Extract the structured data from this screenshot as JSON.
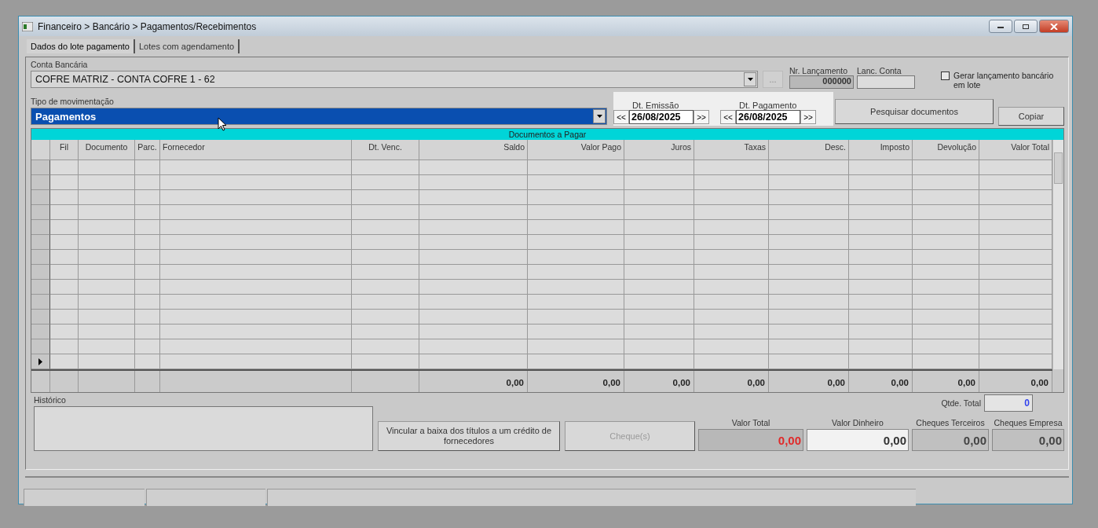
{
  "window": {
    "title": "Financeiro > Bancário > Pagamentos/Recebimentos"
  },
  "tabs": [
    {
      "label": "Dados do lote pagamento",
      "selected": true
    },
    {
      "label": "Lotes com agendamento",
      "selected": false
    }
  ],
  "conta_bancaria": {
    "label": "Conta Bancária",
    "value": "COFRE MATRIZ - CONTA COFRE 1 - 62"
  },
  "browse_button": "...",
  "nr_lancamento": {
    "label": "Nr. Lançamento",
    "value": "000000"
  },
  "lanc_conta": {
    "label": "Lanc. Conta"
  },
  "gerar_lote": {
    "label": "Gerar lançamento bancário em lote",
    "checked": false
  },
  "tipo_movimentacao": {
    "label": "Tipo de movimentação",
    "value": "Pagamentos",
    "selected": true
  },
  "dates": [
    {
      "label": "Dt. Emissão",
      "value": "26/08/2025",
      "prev": "<<",
      "next": ">>"
    },
    {
      "label": "Dt. Pagamento",
      "value": "26/08/2025",
      "prev": "<<",
      "next": ">>"
    }
  ],
  "search_button": "Pesquisar documentos",
  "copy_button": "Copiar",
  "table": {
    "title": "Documentos a Pagar",
    "columns": [
      {
        "label": "Fil"
      },
      {
        "label": "Documento"
      },
      {
        "label": "Parc."
      },
      {
        "label": "Fornecedor"
      },
      {
        "label": "Dt. Venc."
      },
      {
        "label": "Saldo",
        "total": "0,00"
      },
      {
        "label": "Valor Pago",
        "total": "0,00"
      },
      {
        "label": "Juros",
        "total": "0,00"
      },
      {
        "label": "Taxas",
        "total": "0,00"
      },
      {
        "label": "Desc.",
        "total": "0,00"
      },
      {
        "label": "Imposto",
        "total": "0,00"
      },
      {
        "label": "Devolução",
        "total": "0,00"
      },
      {
        "label": "Valor Total",
        "total": "0,00"
      }
    ]
  },
  "historico": {
    "label": "Histórico"
  },
  "vincular_button": "Vincular a baixa dos títulos a um crédito de fornecedores",
  "cheques_button": {
    "label": "Cheque(s)",
    "disabled": true
  },
  "qtde_total": {
    "label": "Qtde. Total",
    "value": "0"
  },
  "summary": [
    {
      "label": "Valor Total",
      "value": "0,00",
      "kind": "alert"
    },
    {
      "label": "Valor Dinheiro",
      "value": "0,00",
      "kind": "editable"
    },
    {
      "label": "Cheques Terceiros",
      "value": "0,00",
      "kind": "readonly"
    },
    {
      "label": "Cheques Empresa",
      "value": "0,00",
      "kind": "readonly"
    }
  ]
}
